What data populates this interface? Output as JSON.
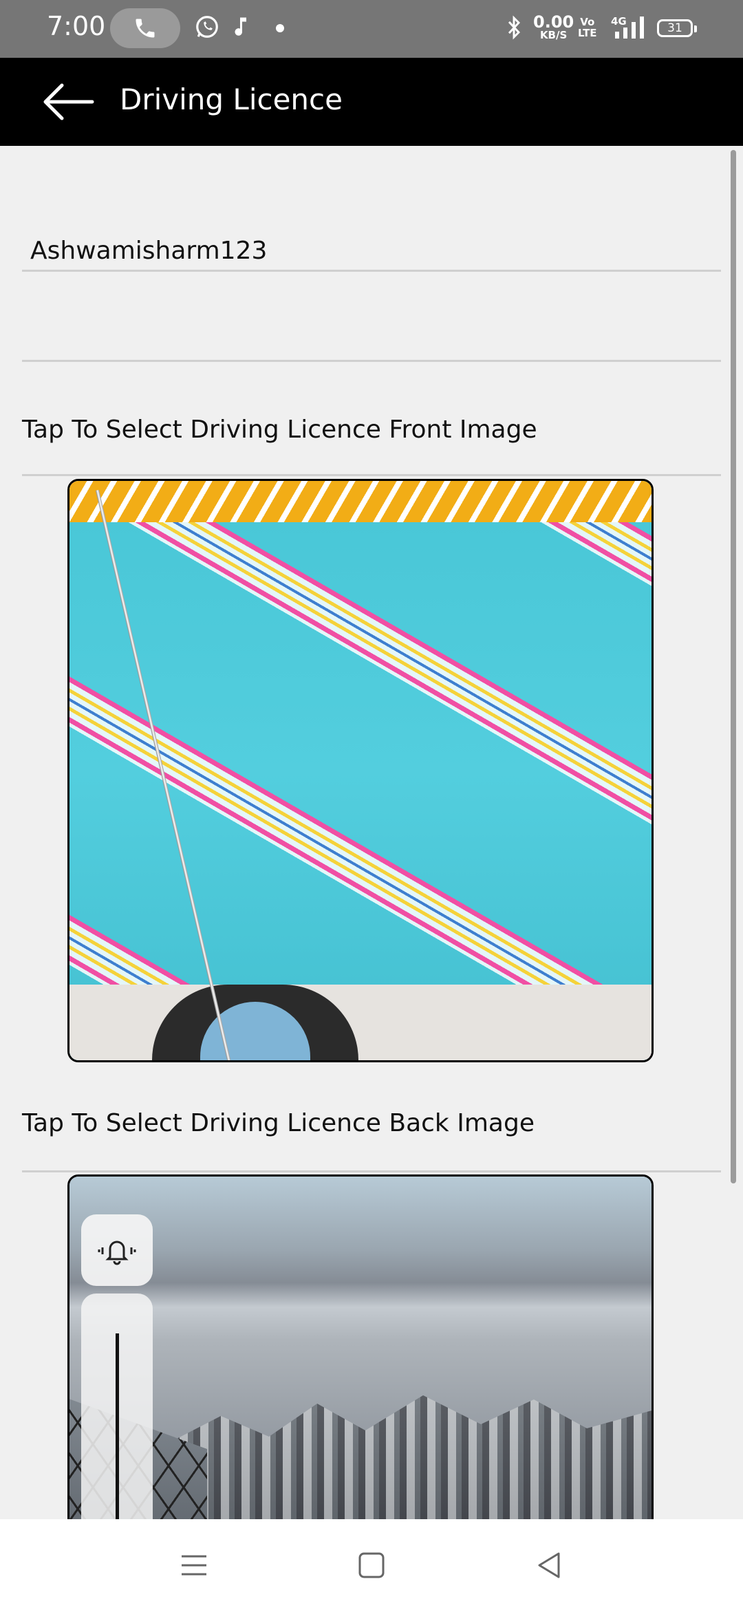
{
  "status_bar": {
    "time": "7:00",
    "icons": [
      "phone-call-icon",
      "whatsapp-icon",
      "music-icon",
      "dot-icon",
      "bluetooth-icon",
      "signal-icon"
    ],
    "network_speed_value": "0.00",
    "network_speed_unit": "KB/S",
    "volte_line1": "Vo",
    "volte_line2": "LTE",
    "network_type": "4G",
    "battery": "31"
  },
  "app_bar": {
    "title": "Driving Licence",
    "back_icon": "arrow-left-icon"
  },
  "form": {
    "username_value": "Ashwamisharm123",
    "second_field_value": "",
    "front_image_label": "Tap To Select Driving Licence Front Image",
    "back_image_label": "Tap To Select Driving Licence Back Image"
  },
  "overlay": {
    "volume_icon": "bell-vibrate-icon"
  },
  "nav_bar": {
    "buttons": [
      "menu-icon",
      "home-square-icon",
      "back-triangle-icon"
    ]
  },
  "colors": {
    "app_bar_bg": "#000000",
    "status_bar_bg": "#767676",
    "page_bg": "#f0f0f0",
    "divider": "#cfcfcf"
  }
}
